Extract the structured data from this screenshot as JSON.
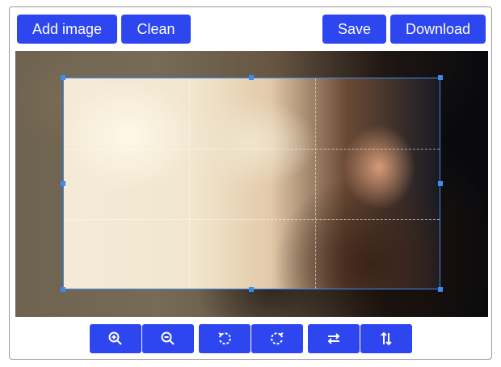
{
  "toolbar": {
    "add_image_label": "Add image",
    "clean_label": "Clean",
    "save_label": "Save",
    "download_label": "Download"
  },
  "colors": {
    "accent": "#2d46f0",
    "crop_border": "#3c8cf0"
  },
  "tools": [
    {
      "icon": "zoom-in-icon"
    },
    {
      "icon": "zoom-out-icon"
    },
    {
      "icon": "rotate-left-icon"
    },
    {
      "icon": "rotate-right-icon"
    },
    {
      "icon": "flip-horizontal-icon"
    },
    {
      "icon": "flip-vertical-icon"
    }
  ]
}
